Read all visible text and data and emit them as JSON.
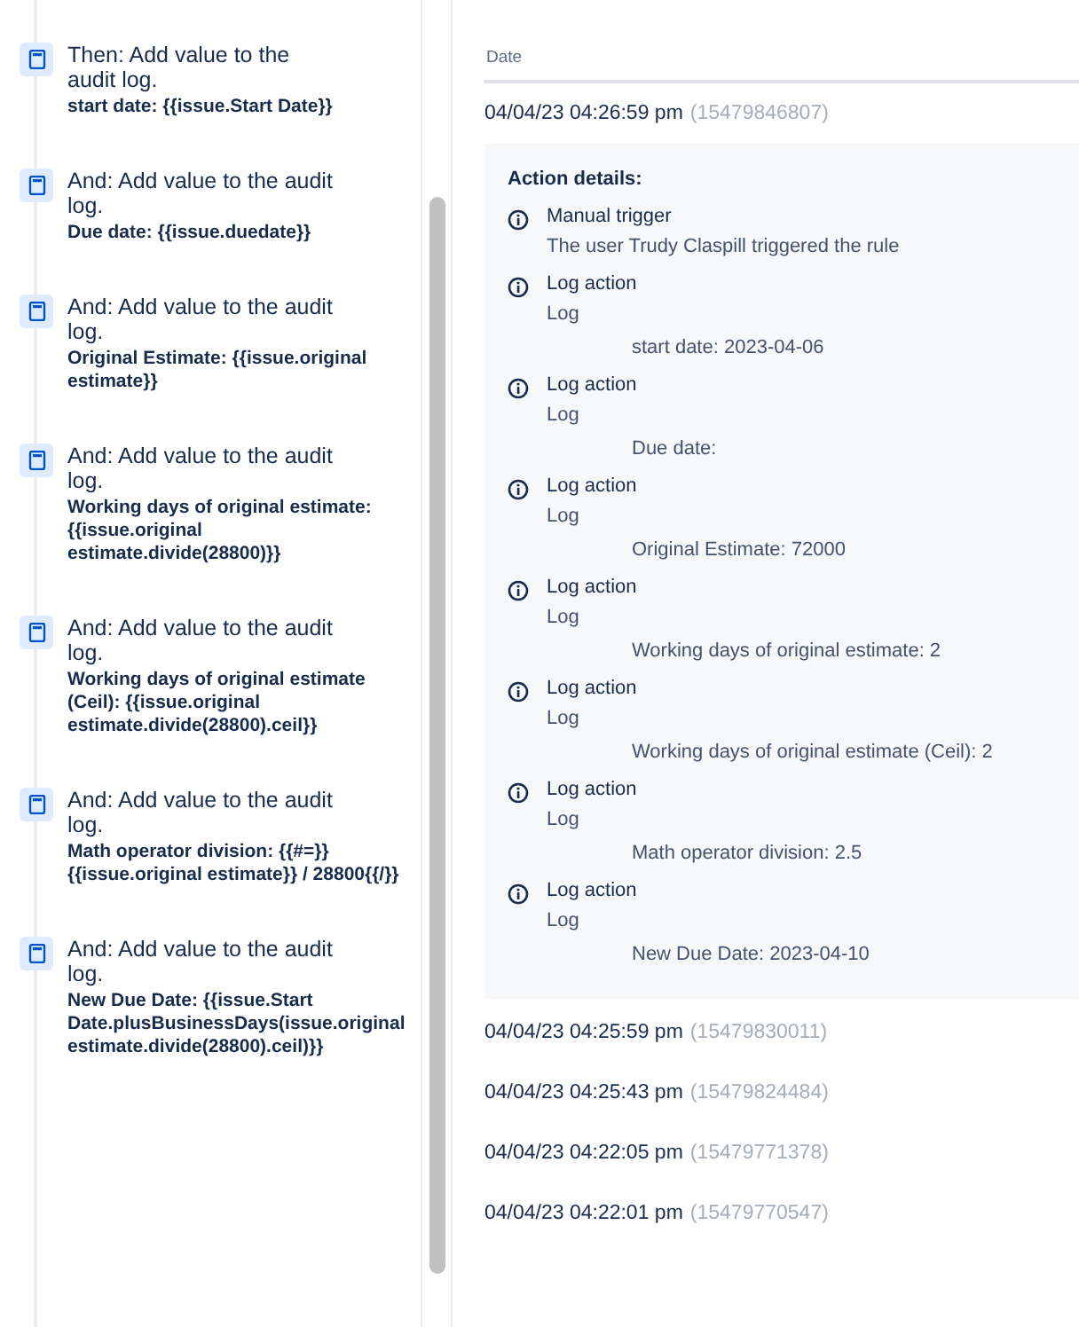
{
  "rule_steps": [
    {
      "title": "Then: Add value to the audit log.",
      "message": "start date: {{issue.Start Date}}"
    },
    {
      "title": "And: Add value to the audit log.",
      "message": "Due date: {{issue.duedate}}"
    },
    {
      "title": "And: Add value to the audit log.",
      "message": "Original Estimate: {{issue.original estimate}}"
    },
    {
      "title": "And: Add value to the audit log.",
      "message": "Working days of original estimate: {{issue.original estimate.divide(28800)}}"
    },
    {
      "title": "And: Add value to the audit log.",
      "message": "Working days of original estimate (Ceil): {{issue.original estimate.divide(28800).ceil}}"
    },
    {
      "title": "And: Add value to the audit log.",
      "message": "Math operator division: {{#=}} {{issue.original estimate}} / 28800{{/}}"
    },
    {
      "title": "And: Add value to the audit log.",
      "message": "New Due Date: {{issue.Start Date.plusBusinessDays(issue.original estimate.divide(28800).ceil)}}"
    }
  ],
  "audit_log": {
    "column": "Date",
    "entries": [
      {
        "date": "04/04/23 04:26:59 pm",
        "id": "(15479846807)",
        "expanded": true,
        "details_title": "Action details:",
        "actions": [
          {
            "title": "Manual trigger",
            "detail": "The user Trudy Claspill triggered the rule"
          },
          {
            "title": "Log action",
            "detail": "Log",
            "message": "start date: 2023-04-06"
          },
          {
            "title": "Log action",
            "detail": "Log",
            "message": "Due date:"
          },
          {
            "title": "Log action",
            "detail": "Log",
            "message": "Original Estimate: 72000"
          },
          {
            "title": "Log action",
            "detail": "Log",
            "message": "Working days of original estimate: 2"
          },
          {
            "title": "Log action",
            "detail": "Log",
            "message": "Working days of original estimate (Ceil): 2"
          },
          {
            "title": "Log action",
            "detail": "Log",
            "message": "Math operator division: 2.5"
          },
          {
            "title": "Log action",
            "detail": "Log",
            "message": "New Due Date: 2023-04-10"
          }
        ]
      },
      {
        "date": "04/04/23 04:25:59 pm",
        "id": "(15479830011)",
        "expanded": false
      },
      {
        "date": "04/04/23 04:25:43 pm",
        "id": "(15479824484)",
        "expanded": false
      },
      {
        "date": "04/04/23 04:22:05 pm",
        "id": "(15479771378)",
        "expanded": false
      },
      {
        "date": "04/04/23 04:22:01 pm",
        "id": "(15479770547)",
        "expanded": false
      }
    ]
  }
}
